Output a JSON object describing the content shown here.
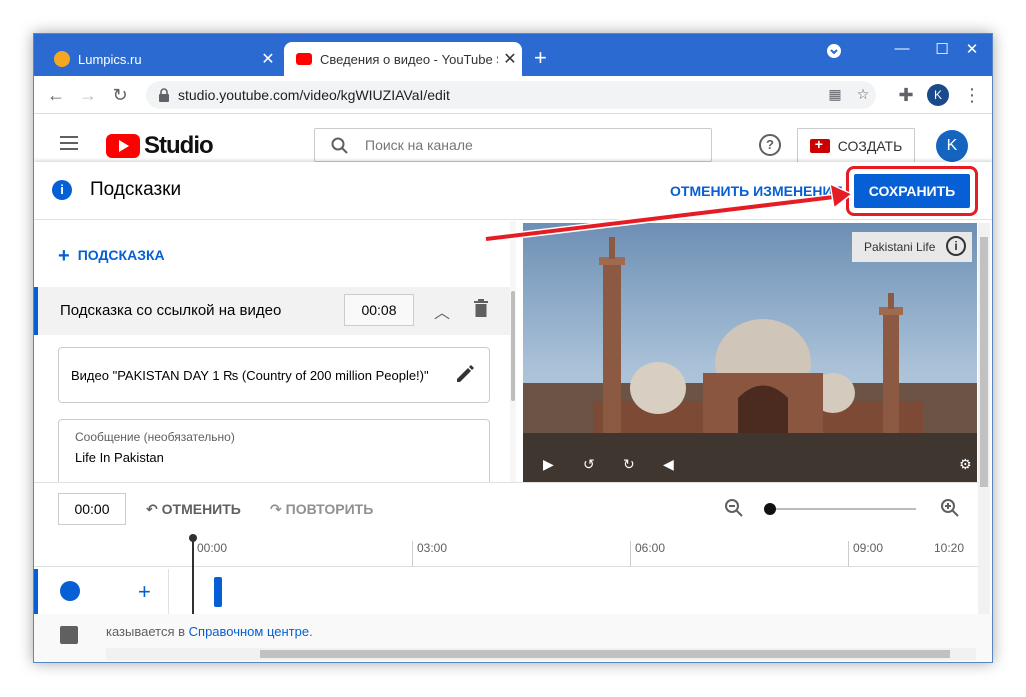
{
  "browser": {
    "tabs": [
      {
        "title": "Lumpics.ru",
        "favicon_color": "#f5a623"
      },
      {
        "title": "Сведения о видео - YouTube St",
        "favicon_color": "#ff0000"
      }
    ],
    "new_tab_label": "+",
    "url": "studio.youtube.com/video/kgWIUZIAVaI/edit",
    "profile_initial": "K"
  },
  "studio": {
    "logo_text": "Studio",
    "search_placeholder": "Поиск на канале",
    "create_label": "СОЗДАТЬ",
    "avatar_initial": "K"
  },
  "editor": {
    "title": "Подсказки",
    "undo_changes_label": "ОТМЕНИТЬ ИЗМЕНЕНИЯ",
    "save_label": "СОХРАНИТЬ",
    "add_card_label": "ПОДСКАЗКА",
    "card": {
      "label": "Подсказка со ссылкой на видео",
      "time": "00:08",
      "video_value": "Видео \"PAKISTAN DAY 1 ₨ (Country of 200 million People!)\"",
      "message_label": "Сообщение (необязательно)",
      "message_value": "Life In Pakistan"
    },
    "video": {
      "channel_watermark": "Pakistani Life"
    }
  },
  "timeline": {
    "current_time": "00:00",
    "undo_label": "ОТМЕНИТЬ",
    "redo_label": "ПОВТОРИТЬ",
    "ticks": [
      "00:00",
      "03:00",
      "06:00",
      "09:00",
      "10:20"
    ]
  },
  "background_page": {
    "text_prefix": "казывается в ",
    "link_text": "Справочном центре",
    "text_suffix": "."
  },
  "colors": {
    "accent": "#065fd4",
    "highlight": "#e51c23",
    "titlebar": "#2b6bd1"
  }
}
